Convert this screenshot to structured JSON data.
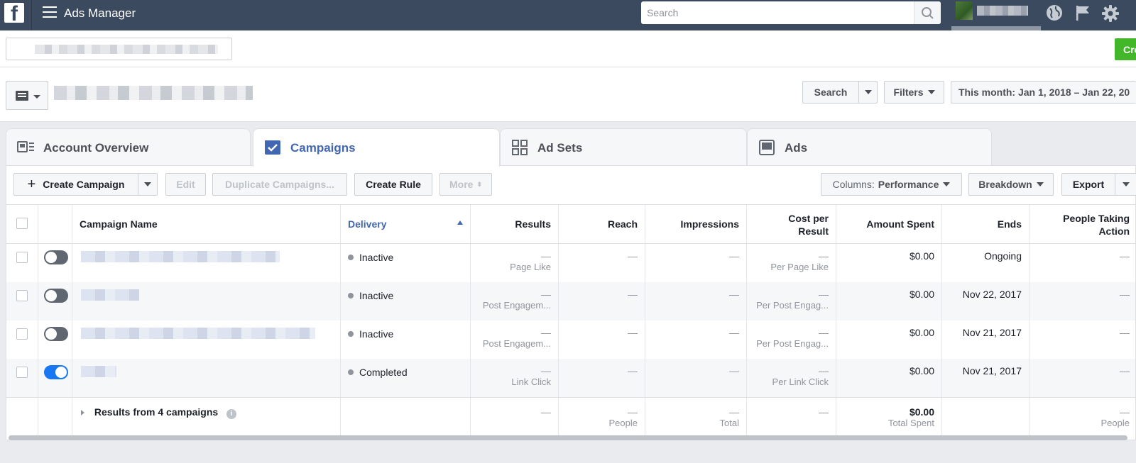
{
  "topbar": {
    "app_title": "Ads Manager",
    "search_placeholder": "Search"
  },
  "account_bar": {
    "create_label": "Cre"
  },
  "filter_bar": {
    "search_label": "Search",
    "filters_label": "Filters",
    "date_range": "This month: Jan 1, 2018 – Jan 22, 20"
  },
  "tabs": [
    {
      "label": "Account Overview",
      "icon": "account-overview-icon"
    },
    {
      "label": "Campaigns",
      "icon": "campaigns-check-icon"
    },
    {
      "label": "Ad Sets",
      "icon": "ad-sets-grid-icon"
    },
    {
      "label": "Ads",
      "icon": "ads-icon"
    }
  ],
  "toolbar": {
    "create_campaign": "Create Campaign",
    "edit": "Edit",
    "duplicate": "Duplicate Campaigns...",
    "create_rule": "Create Rule",
    "more": "More",
    "columns_prefix": "Columns:",
    "columns_value": "Performance",
    "breakdown": "Breakdown",
    "export": "Export"
  },
  "table": {
    "headers": {
      "campaign_name": "Campaign Name",
      "delivery": "Delivery",
      "results": "Results",
      "reach": "Reach",
      "impressions": "Impressions",
      "cost_per_result_1": "Cost per",
      "cost_per_result_2": "Result",
      "amount_spent": "Amount Spent",
      "ends": "Ends",
      "people_taking_action_1": "People Taking",
      "people_taking_action_2": "Action"
    },
    "dash": "—",
    "rows": [
      {
        "toggle_on": false,
        "delivery": "Inactive",
        "results_sub": "Page Like",
        "cost_sub": "Per Page Like",
        "amount": "$0.00",
        "ends": "Ongoing"
      },
      {
        "toggle_on": false,
        "delivery": "Inactive",
        "results_sub": "Post Engagem...",
        "cost_sub": "Per Post Engag...",
        "amount": "$0.00",
        "ends": "Nov 22, 2017"
      },
      {
        "toggle_on": false,
        "delivery": "Inactive",
        "results_sub": "Post Engagem...",
        "cost_sub": "Per Post Engag...",
        "amount": "$0.00",
        "ends": "Nov 21, 2017"
      },
      {
        "toggle_on": true,
        "delivery": "Completed",
        "results_sub": "Link Click",
        "cost_sub": "Per Link Click",
        "amount": "$0.00",
        "ends": "Nov 21, 2017"
      }
    ],
    "footer": {
      "label": "Results from 4 campaigns",
      "reach_sub": "People",
      "impressions_sub": "Total",
      "amount": "$0.00",
      "amount_sub": "Total Spent",
      "people_sub": "People"
    }
  },
  "colors": {
    "topbar": "#3b4a5e",
    "accent": "#4267b2",
    "create_green": "#42b72a",
    "toggle_on": "#1877f2"
  }
}
